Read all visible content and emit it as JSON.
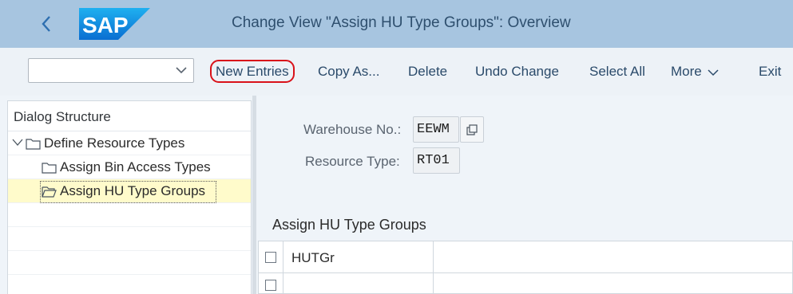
{
  "header": {
    "title": "Change View \"Assign HU Type Groups\": Overview",
    "logo_text": "SAP",
    "back_icon": "chevron-left-icon",
    "bg_color": "#a7c5e0"
  },
  "toolbar": {
    "select_value": "",
    "new_entries": "New Entries",
    "copy_as": "Copy As...",
    "delete": "Delete",
    "undo_change": "Undo Change",
    "select_all": "Select All",
    "more": "More",
    "exit": "Exit"
  },
  "dialog_structure": {
    "title": "Dialog Structure",
    "items": [
      {
        "label": "Define Resource Types",
        "expanded": true
      },
      {
        "label": "Assign Bin Access Types"
      },
      {
        "label": "Assign HU Type Groups",
        "selected": true
      }
    ]
  },
  "fields": {
    "warehouse_label": "Warehouse No.:",
    "warehouse_value": "EEWM",
    "resource_type_label": "Resource Type:",
    "resource_type_value": "RT01"
  },
  "table": {
    "title": "Assign HU Type Groups",
    "columns": [
      "HUTGr"
    ]
  }
}
